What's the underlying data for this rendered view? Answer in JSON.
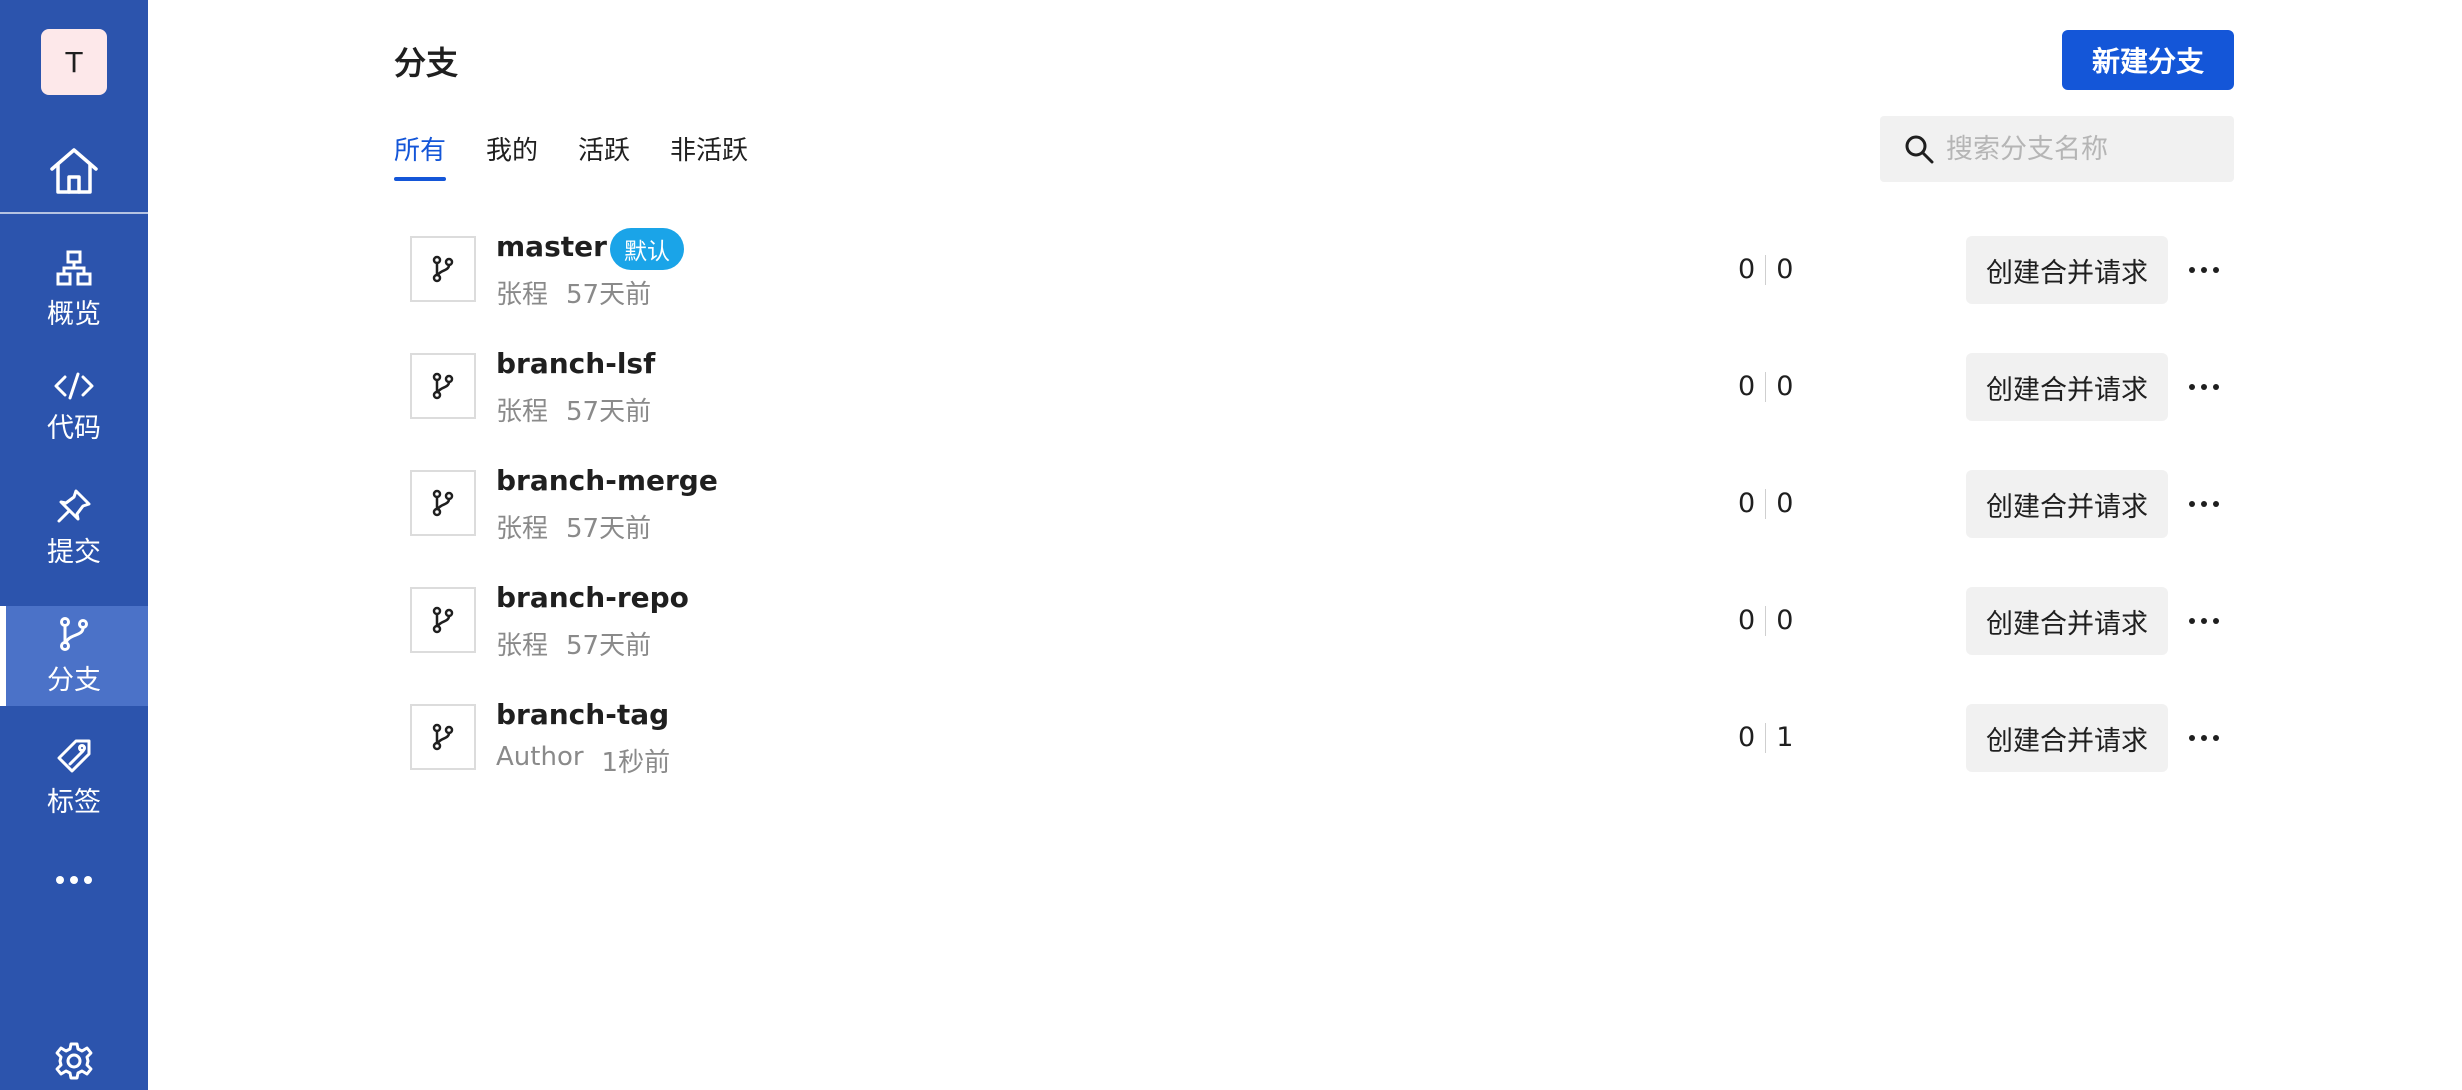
{
  "user": {
    "avatar_initial": "T"
  },
  "sidebar": {
    "items": [
      {
        "label": "概览",
        "icon": "overview-icon"
      },
      {
        "label": "代码",
        "icon": "code-icon"
      },
      {
        "label": "提交",
        "icon": "pin-icon"
      },
      {
        "label": "分支",
        "icon": "branch-icon",
        "active": true
      },
      {
        "label": "标签",
        "icon": "tag-icon"
      }
    ]
  },
  "header": {
    "title": "分支",
    "new_branch_label": "新建分支"
  },
  "tabs": [
    {
      "label": "所有",
      "active": true
    },
    {
      "label": "我的"
    },
    {
      "label": "活跃"
    },
    {
      "label": "非活跃"
    }
  ],
  "search": {
    "placeholder": "搜索分支名称"
  },
  "branches": [
    {
      "name": "master",
      "badge": "默认",
      "author": "张程",
      "time": "57天前",
      "behind": "0",
      "ahead": "0",
      "action_label": "创建合并请求"
    },
    {
      "name": "branch-lsf",
      "author": "张程",
      "time": "57天前",
      "behind": "0",
      "ahead": "0",
      "action_label": "创建合并请求"
    },
    {
      "name": "branch-merge",
      "author": "张程",
      "time": "57天前",
      "behind": "0",
      "ahead": "0",
      "action_label": "创建合并请求"
    },
    {
      "name": "branch-repo",
      "author": "张程",
      "time": "57天前",
      "behind": "0",
      "ahead": "0",
      "action_label": "创建合并请求"
    },
    {
      "name": "branch-tag",
      "author": "Author",
      "time": "1秒前",
      "behind": "0",
      "ahead": "1",
      "action_label": "创建合并请求"
    }
  ],
  "colors": {
    "sidebar_bg": "#2c54ad",
    "sidebar_active": "#4b72c8",
    "primary": "#1456d8",
    "badge": "#1aa4e8"
  }
}
